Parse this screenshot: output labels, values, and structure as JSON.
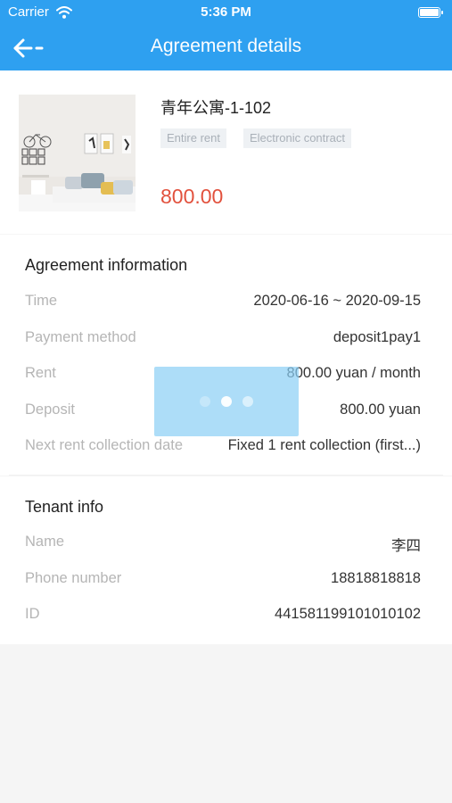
{
  "status_bar": {
    "carrier": "Carrier",
    "time": "5:36 PM"
  },
  "nav": {
    "title": "Agreement details",
    "back_icon": "back-arrow-icon"
  },
  "property": {
    "title": "青年公寓-1-102",
    "tags": [
      "Entire rent",
      "Electronic contract"
    ],
    "price": "800.00"
  },
  "agreement": {
    "title": "Agreement information",
    "rows": [
      {
        "label": "Time",
        "value": "2020-06-16 ~ 2020-09-15"
      },
      {
        "label": "Payment method",
        "value": "deposit1pay1"
      },
      {
        "label": "Rent",
        "value": "800.00 yuan / month"
      },
      {
        "label": "Deposit",
        "value": "800.00 yuan"
      },
      {
        "label": "Next rent collection date",
        "value": "Fixed 1 rent collection (first...)"
      }
    ]
  },
  "tenant": {
    "title": "Tenant info",
    "rows": [
      {
        "label": "Name",
        "value": "李四"
      },
      {
        "label": "Phone number",
        "value": "18818818818"
      },
      {
        "label": "ID",
        "value": "441581199101010102"
      }
    ]
  },
  "colors": {
    "accent": "#2ea0f0",
    "price": "#e2513d"
  }
}
